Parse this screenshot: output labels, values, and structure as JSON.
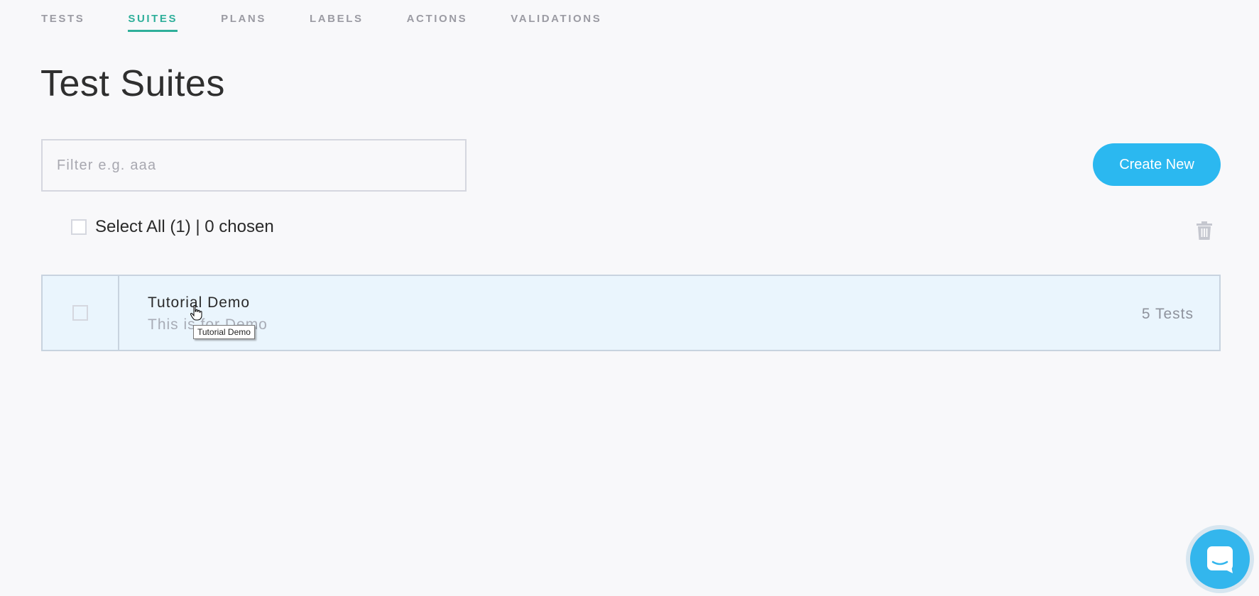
{
  "nav": {
    "tabs": [
      {
        "label": "TESTS",
        "active": false
      },
      {
        "label": "SUITES",
        "active": true
      },
      {
        "label": "PLANS",
        "active": false
      },
      {
        "label": "LABELS",
        "active": false
      },
      {
        "label": "ACTIONS",
        "active": false
      },
      {
        "label": "VALIDATIONS",
        "active": false
      }
    ]
  },
  "page": {
    "title": "Test Suites"
  },
  "filter": {
    "placeholder": "Filter e.g. aaa",
    "value": ""
  },
  "toolbar": {
    "create_label": "Create New",
    "select_all_label": "Select All (1) | 0 chosen",
    "trash_icon": "trash-icon"
  },
  "suites": [
    {
      "title": "Tutorial Demo",
      "description": "This is for Demo",
      "count": "5 Tests",
      "checked": false
    }
  ],
  "tooltip": {
    "text": "Tutorial Demo"
  },
  "chat": {
    "icon": "chat-icon"
  },
  "colors": {
    "accent": "#2eaf9a",
    "primary_button": "#2bb8f0",
    "row_highlight": "#eaf5fd",
    "chat": "#33b6ed"
  }
}
